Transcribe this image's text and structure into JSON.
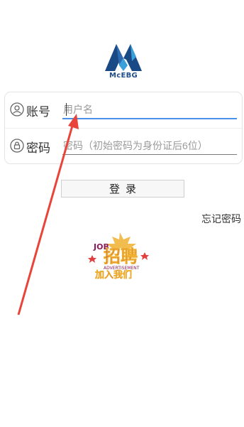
{
  "brand": {
    "name": "McEBG"
  },
  "login_form": {
    "account": {
      "label": "账号",
      "icon": "user-icon",
      "placeholder": "用户名",
      "value": ""
    },
    "password": {
      "label": "密码",
      "icon": "lock-icon",
      "placeholder": "密码（初始密码为身份证后6位）",
      "value": ""
    }
  },
  "actions": {
    "login_label": "登录",
    "forgot_label": "忘记密码"
  },
  "recruit_badge": {
    "title": "招聘",
    "subtitle": "ADVERTISEMENT",
    "top": "JOB",
    "bottom": "加入我们"
  },
  "colors": {
    "brand_blue": "#1e4f8a",
    "focus_blue": "#4a8fe8",
    "arrow_red": "#e8443a",
    "badge_purple": "#8b1a5a",
    "badge_gold": "#f0b030"
  }
}
